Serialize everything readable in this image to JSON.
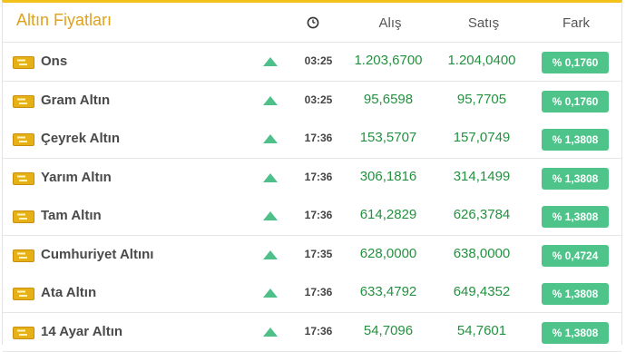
{
  "title": "Altın Fiyatları",
  "columns": {
    "time_icon": "clock-icon",
    "buy": "Alış",
    "sell": "Satış",
    "diff": "Fark"
  },
  "colors": {
    "accent": "#f2c21b",
    "title": "#e0a11b",
    "up": "#4fc08a",
    "value": "#23913f",
    "badge": "#4ec48b"
  },
  "rows": [
    {
      "name": "Ons",
      "time": "03:25",
      "buy": "1.203,6700",
      "sell": "1.204,0400",
      "diff": "% 0,1760",
      "trend": "up"
    },
    {
      "name": "Gram Altın",
      "time": "03:25",
      "buy": "95,6598",
      "sell": "95,7705",
      "diff": "% 0,1760",
      "trend": "up"
    },
    {
      "name": "Çeyrek Altın",
      "time": "17:36",
      "buy": "153,5707",
      "sell": "157,0749",
      "diff": "% 1,3808",
      "trend": "up"
    },
    {
      "name": "Yarım Altın",
      "time": "17:36",
      "buy": "306,1816",
      "sell": "314,1499",
      "diff": "% 1,3808",
      "trend": "up"
    },
    {
      "name": "Tam Altın",
      "time": "17:36",
      "buy": "614,2829",
      "sell": "626,3784",
      "diff": "% 1,3808",
      "trend": "up"
    },
    {
      "name": "Cumhuriyet Altını",
      "time": "17:35",
      "buy": "628,0000",
      "sell": "638,0000",
      "diff": "% 0,4724",
      "trend": "up"
    },
    {
      "name": "Ata Altın",
      "time": "17:36",
      "buy": "633,4792",
      "sell": "649,4352",
      "diff": "% 1,3808",
      "trend": "up"
    },
    {
      "name": "14 Ayar Altın",
      "time": "17:36",
      "buy": "54,7096",
      "sell": "54,7601",
      "diff": "% 1,3808",
      "trend": "up"
    }
  ]
}
